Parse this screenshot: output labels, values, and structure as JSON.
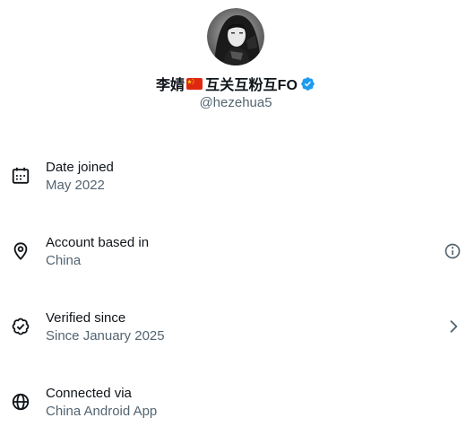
{
  "profile": {
    "display_name_prefix": "李婧",
    "display_name_suffix": "互关互粉互FO",
    "handle": "@hezehua5"
  },
  "rows": [
    {
      "title": "Date joined",
      "value": "May 2022",
      "icon": "calendar-icon"
    },
    {
      "title": "Account based in",
      "value": "China",
      "icon": "location-pin-icon",
      "trailing": "info-icon"
    },
    {
      "title": "Verified since",
      "value": "Since January 2025",
      "icon": "verified-badge-icon",
      "trailing": "chevron-right-icon"
    },
    {
      "title": "Connected via",
      "value": "China Android App",
      "icon": "globe-icon"
    }
  ],
  "colors": {
    "text_primary": "#0f1419",
    "text_secondary": "#536471",
    "verified_blue": "#1d9bf0"
  }
}
